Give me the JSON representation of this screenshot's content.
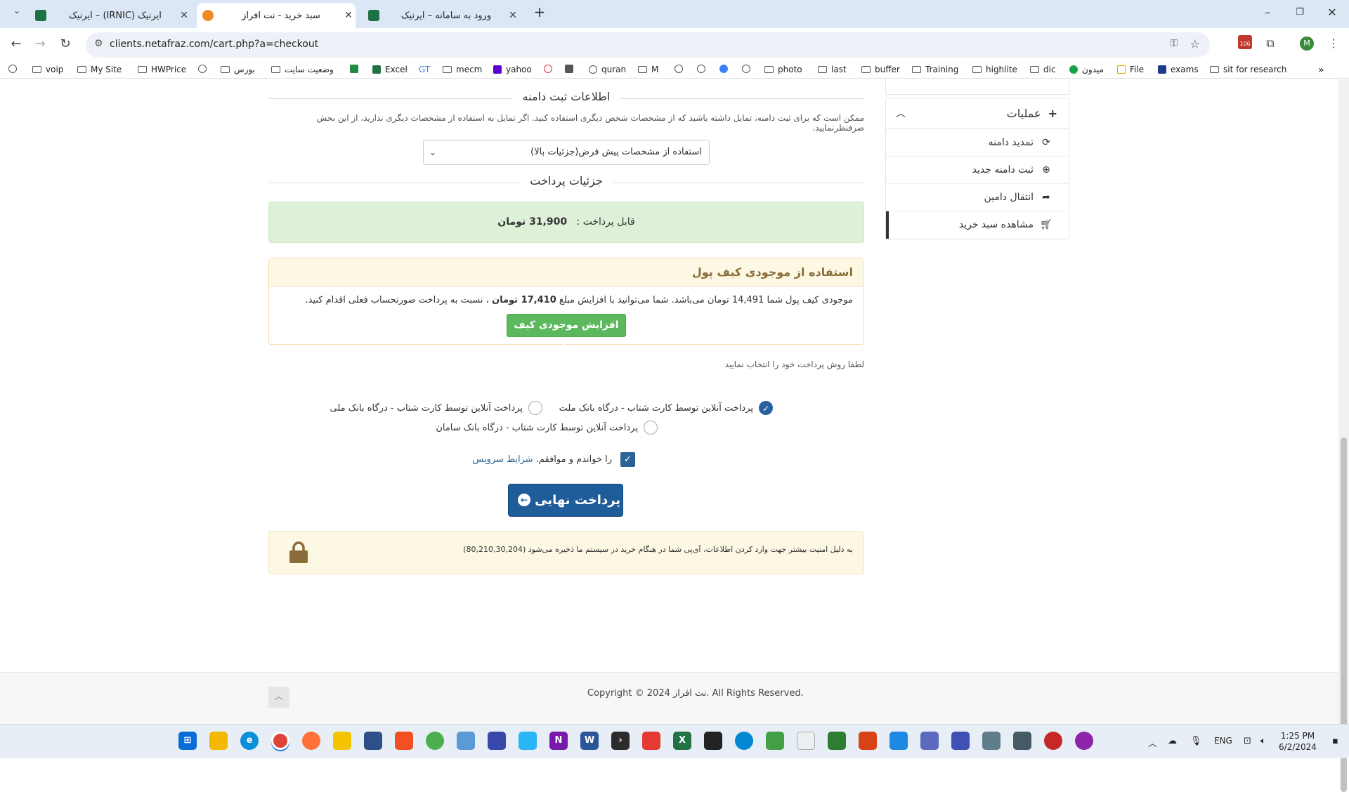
{
  "browser": {
    "tabs": [
      {
        "title": "ایرنیک – (IRNIC) ایرنیک",
        "active": false
      },
      {
        "title": "سبد خرید - نت افراز",
        "active": true
      },
      {
        "title": "ورود به سامانه – ایرنیک",
        "active": false
      }
    ],
    "url": "clients.netafraz.com/cart.php?a=checkout",
    "profile_initial": "M",
    "extension_badge": "106"
  },
  "bookmarks": [
    "voip",
    "My Site",
    "HWPrice",
    "بورس",
    "وضعیت سایت",
    "Excel",
    "GT",
    "mecm",
    "yahoo",
    "quran",
    "M",
    "photo",
    "last",
    "buffer",
    "Training",
    "highlite",
    "dic",
    "میدون",
    "File",
    "exams",
    "sit for research"
  ],
  "main": {
    "domain_reg_title": "اطلاعات ثبت دامنه",
    "domain_reg_note": "ممکن است که برای ثبت دامنه، تمایل داشته باشید که از مشخصات شخص دیگری استفاده کنید. اگر تمایل به استفاده از مشخصات دیگری ندارید، از این بخش صرفنظرنمایید.",
    "contact_select_value": "استفاده از مشخصات پیش فرض(جزئیات بالا)",
    "payment_details_title": "جزئیات پرداخت",
    "payable_label": "قابل پرداخت :",
    "payable_amount": "31,900 تومان",
    "wallet_title": "استفاده از موجودی کیف پول",
    "wallet_text_1": "موجودی کیف پول شما 14,491 تومان می‌باشد. شما می‌توانید با افزایش مبلغ",
    "wallet_topup_amount": "17,410 تومان",
    "wallet_text_2": "، نسبت به پرداخت صورتحساب فعلی اقدام کنید.",
    "wallet_button": "افزایش موجودی کیف پول",
    "payment_method_title": "لطفا روش پرداخت خود را انتخاب نمایید",
    "payment_methods": [
      {
        "label": "پرداخت آنلاین توسط کارت شتاب - درگاه بانک ملت",
        "selected": true
      },
      {
        "label": "پرداخت آنلاین توسط کارت شتاب - درگاه بانک ملی",
        "selected": false
      },
      {
        "label": "پرداخت آنلاین توسط کارت شتاب - درگاه بانک سامان",
        "selected": false
      }
    ],
    "tos_text": "را خواندم و موافقم.",
    "tos_link": "شرایط سرویس",
    "final_button": "پرداخت نهایی",
    "ip_notice": "به دلیل امنیت بیشتر جهت وارد کردن اطلاعات، آی‌پی شما در هنگام خرید در سیستم ما ذخیره می‌شود (80,210,30,204)"
  },
  "sidebar": {
    "panel_title": "عملیات",
    "items": [
      {
        "label": "تمدید دامنه",
        "icon": "refresh-icon"
      },
      {
        "label": "ثبت دامنه جدید",
        "icon": "globe-icon"
      },
      {
        "label": "انتقال دامین",
        "icon": "share-icon"
      },
      {
        "label": "مشاهده سبد خرید",
        "icon": "cart-icon"
      }
    ]
  },
  "footer": {
    "copyright": "Copyright © 2024 نت افراز. All Rights Reserved."
  },
  "taskbar": {
    "lang": "ENG",
    "time": "1:25 PM",
    "date": "6/2/2024"
  },
  "colors": {
    "primary": "#1f5c9a",
    "success": "#5cb85c",
    "warning_bg": "#fcf8e3",
    "success_bg": "#dff0d8"
  }
}
